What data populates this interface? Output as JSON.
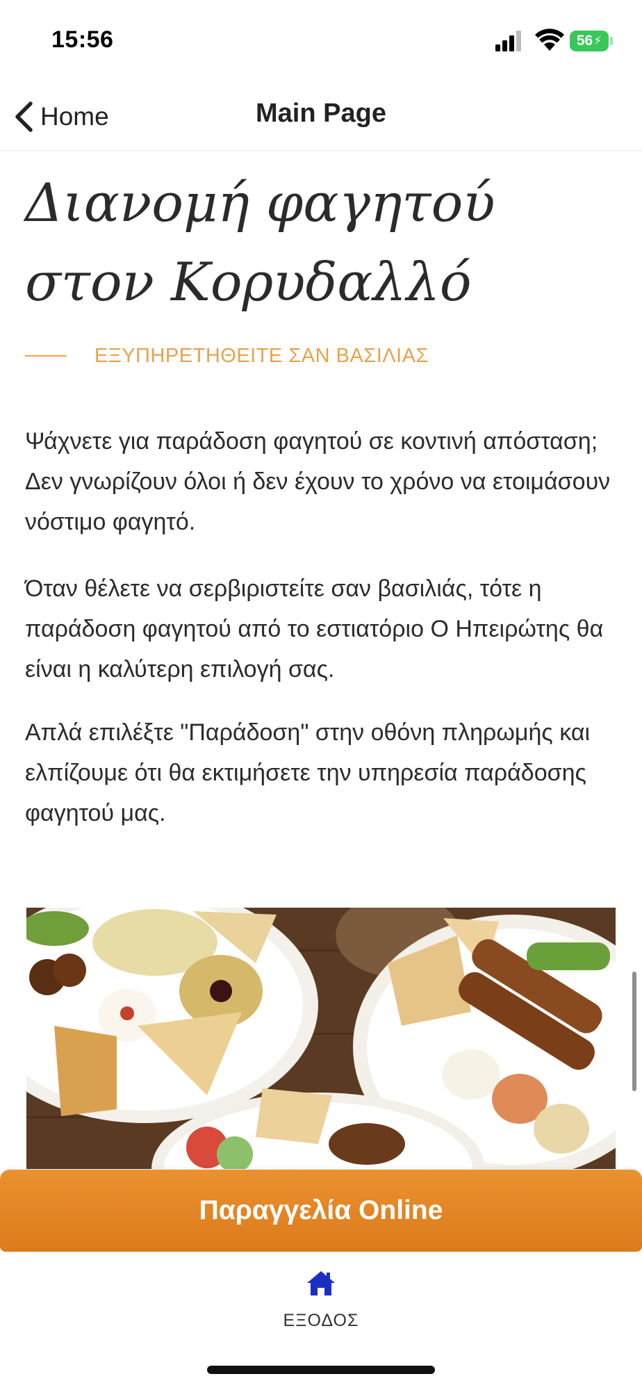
{
  "status_bar": {
    "time": "15:56",
    "battery_level": "56"
  },
  "nav": {
    "back_label": "Home",
    "title": "Main Page"
  },
  "content": {
    "title": "Διανομή φαγητού στον Κορυδαλλό",
    "subtitle": "ΕΞΥΠΗΡΕΤΗΘΕΙΤΕ ΣΑΝ ΒΑΣΙΛΙΑΣ",
    "paragraphs": [
      "Ψάχνετε για παράδοση φαγητού σε κοντινή απόσταση; Δεν γνωρίζουν όλοι ή δεν έχουν το χρόνο να ετοιμάσουν νόστιμο φαγητό.",
      "Όταν θέλετε να σερβιριστείτε σαν βασιλιάς, τότε η παράδοση φαγητού από το εστιατόριο Ο Ηπειρώτης θα είναι η καλύτερη επιλογή σας.",
      "Απλά επιλέξτε \"Παράδοση\" στην οθόνη πληρωμής και ελπίζουμε ότι θα εκτιμήσετε την υπηρεσία παράδοσης φαγητού μας."
    ]
  },
  "order_button": {
    "label": "Παραγγελία Online"
  },
  "tab_bar": {
    "items": [
      {
        "label": "ΕΞΟΔΟΣ",
        "icon": "home-icon"
      }
    ]
  },
  "colors": {
    "accent": "#e8a24c",
    "order_button": "#e08424",
    "tab_icon": "#1b2fc4",
    "battery": "#38c859"
  }
}
